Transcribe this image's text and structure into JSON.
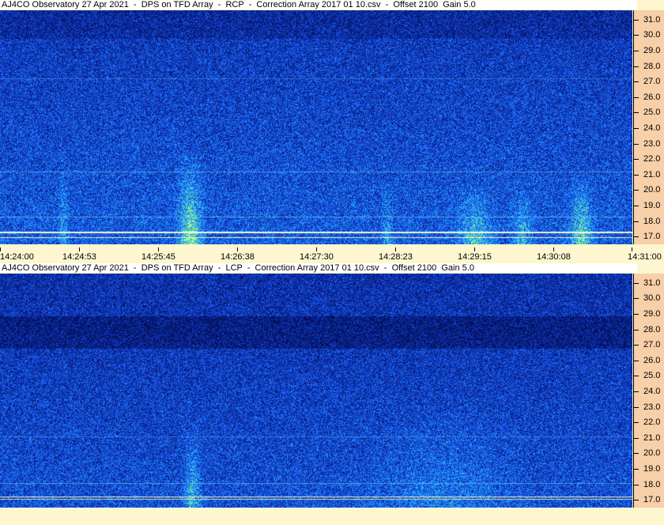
{
  "panels": [
    {
      "title": "AJ4CO Observatory 27 Apr 2021  -  DPS on TFD Array  -  RCP  -  Correction Array 2017 01 10.csv  -  Offset 2100  Gain 5.0",
      "yticks": [
        "31.0",
        "30.0",
        "29.0",
        "28.0",
        "27.0",
        "26.0",
        "25.0",
        "24.0",
        "23.0",
        "22.0",
        "21.0",
        "20.0",
        "19.0",
        "18.0",
        "17.0"
      ],
      "xticks": [
        "14:24:00",
        "14:24:53",
        "14:25:45",
        "14:26:38",
        "14:27:30",
        "14:28:23",
        "14:29:15",
        "14:30:08",
        "14:31:00"
      ]
    },
    {
      "title": "AJ4CO Observatory 27 Apr 2021  -  DPS on TFD Array  -  LCP  -  Correction Array 2017 01 10.csv  -  Offset 2100  Gain 5.0",
      "yticks": [
        "31.0",
        "30.0",
        "29.0",
        "28.0",
        "27.0",
        "26.0",
        "25.0",
        "24.0",
        "23.0",
        "22.0",
        "21.0",
        "20.0",
        "19.0",
        "18.0",
        "17.0"
      ],
      "xticks": []
    }
  ],
  "chart_data": [
    {
      "type": "heatmap",
      "title": "AJ4CO Observatory 27 Apr 2021  -  DPS on TFD Array  -  RCP  -  Correction Array 2017 01 10.csv  -  Offset 2100  Gain 5.0",
      "x_range": [
        "14:24:00",
        "14:31:00"
      ],
      "y_range_MHz": [
        16.5,
        31.6
      ],
      "colormap": [
        "#000033",
        "#0a2f9e",
        "#1f6dff",
        "#2fd0ff",
        "#9cff60",
        "#ffff80"
      ],
      "features": "narrowband horizontal interference lines near 17 MHz; vertical bursts near 14:25:45 and 14:29:15-14:30:40"
    },
    {
      "type": "heatmap",
      "title": "AJ4CO Observatory 27 Apr 2021  -  DPS on TFD Array  -  LCP  -  Correction Array 2017 01 10.csv  -  Offset 2100  Gain 5.0",
      "x_range": [
        "14:24:00",
        "14:31:00"
      ],
      "y_range_MHz": [
        16.5,
        31.6
      ],
      "colormap": [
        "#000033",
        "#0a2f9e",
        "#1f6dff",
        "#2fd0ff",
        "#9cff60",
        "#ffff80"
      ],
      "features": "darker band near 29-30 MHz; bright interference lines near 17 MHz"
    }
  ]
}
